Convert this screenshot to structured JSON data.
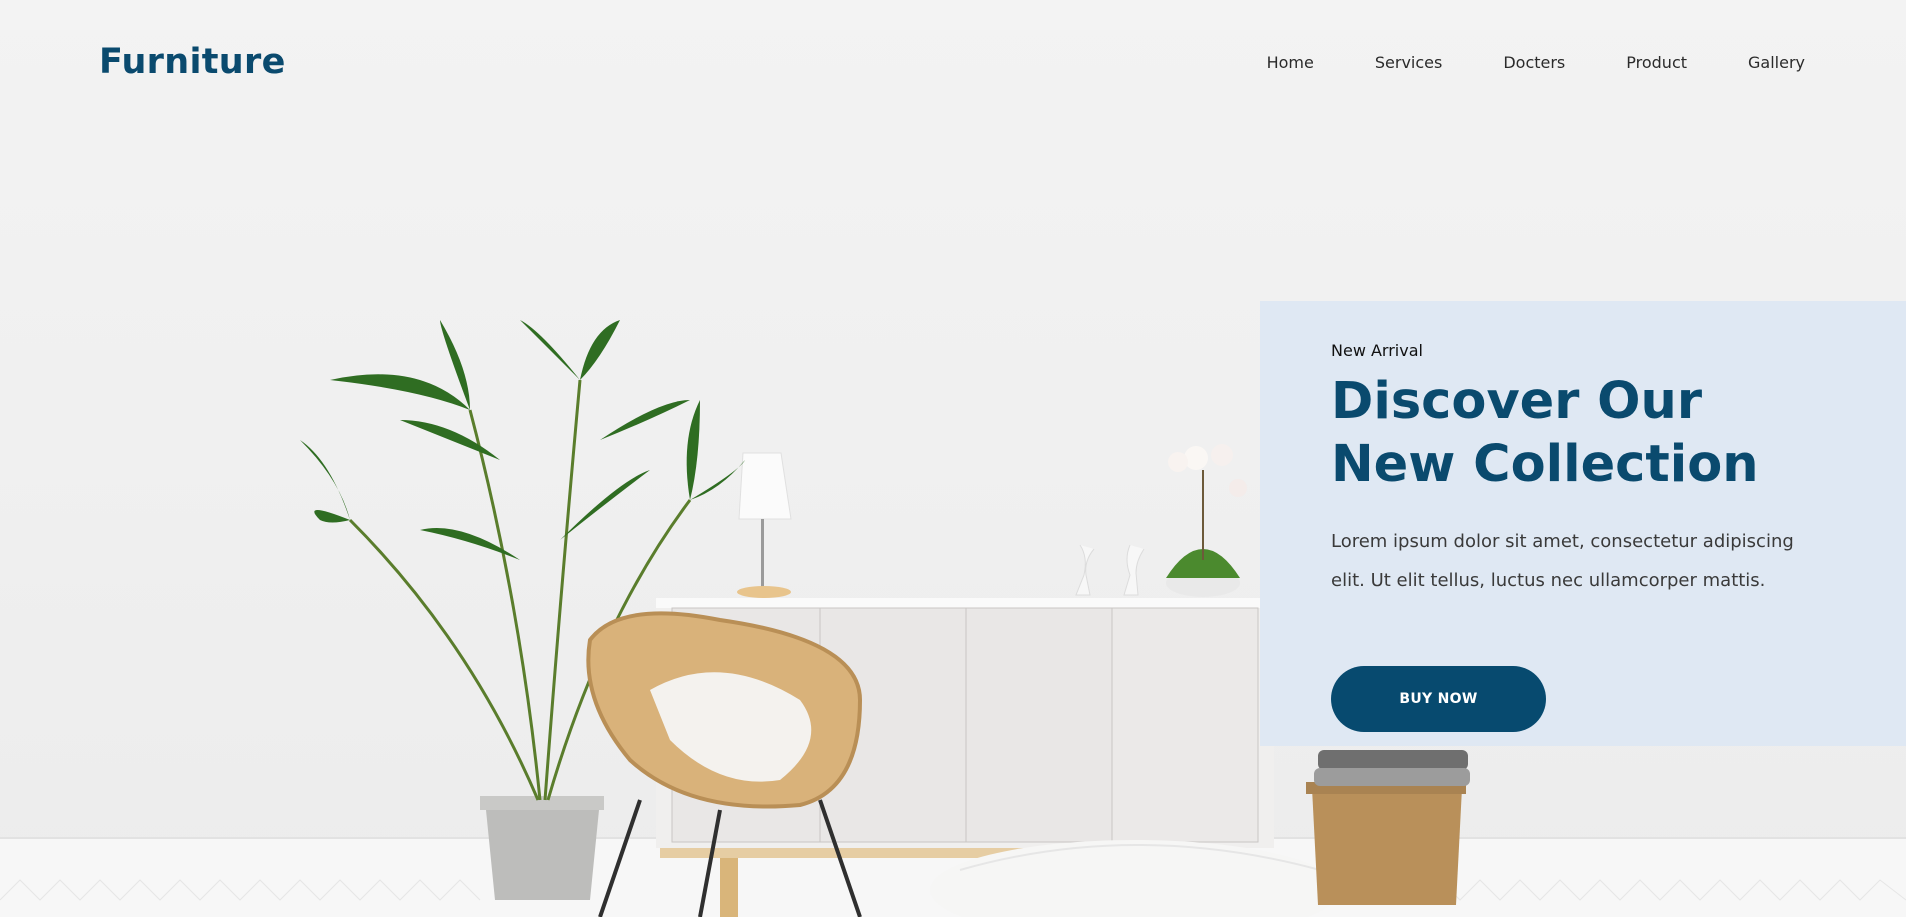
{
  "brand": {
    "logo_text": "Furniture"
  },
  "nav": {
    "items": [
      {
        "label": "Home"
      },
      {
        "label": "Services"
      },
      {
        "label": "Docters"
      },
      {
        "label": "Product"
      },
      {
        "label": "Gallery"
      }
    ]
  },
  "hero": {
    "eyebrow": "New Arrival",
    "headline_line1": "Discover Our",
    "headline_line2": "New Collection",
    "description": "Lorem ipsum dolor sit amet, consectetur adipiscing elit. Ut elit tellus, luctus nec ullamcorper mattis.",
    "cta_label": "BUY NOW"
  },
  "colors": {
    "brand": "#0a4a6e",
    "card_bg": "#dfe8f3",
    "button_bg": "#074a6f"
  }
}
